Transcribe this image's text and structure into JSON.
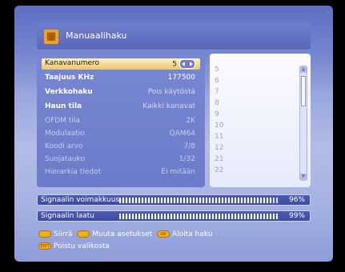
{
  "header": {
    "title": "Manuaalihaku",
    "icon": "menu-grid-icon"
  },
  "settings": [
    {
      "label": "Kanavanumero",
      "value": "5",
      "style": "highlight"
    },
    {
      "label": "Taajuus KHz",
      "value": "177500",
      "style": "bold"
    },
    {
      "label": "Verkkohaku",
      "value": "Pois käytöstä",
      "style": "bold-grey"
    },
    {
      "label": "Haun tila",
      "value": "Kaikki kanavat",
      "style": "bold-grey"
    },
    {
      "label": "OFDM tila",
      "value": "2K",
      "style": "dim"
    },
    {
      "label": "Modulaatio",
      "value": "QAM64",
      "style": "dim"
    },
    {
      "label": "Koodi arvo",
      "value": "7/8",
      "style": "dim"
    },
    {
      "label": "Suojatauko",
      "value": "1/32",
      "style": "dim"
    },
    {
      "label": "Hierarkia tiedot",
      "value": "Ei mitään",
      "style": "dim"
    }
  ],
  "channel_list": [
    "5",
    "6",
    "7",
    "8",
    "9",
    "10",
    "11",
    "12",
    "21",
    "22"
  ],
  "signal": {
    "strength": {
      "label": "Signaalin voimakkuus",
      "percent": 96,
      "percent_text": "96%"
    },
    "quality": {
      "label": "Signaalin laatu",
      "percent": 99,
      "percent_text": "99%"
    }
  },
  "help": {
    "move": "Siirrä",
    "change": "Muuta asetukset",
    "start": "Aloita haku",
    "exit": "Poistu valikosta",
    "ok_key": "OK",
    "exit_key": "EXIT"
  },
  "colors": {
    "highlight": "#ecc470",
    "accent_key": "#f2b018",
    "panel": "#7384cf"
  }
}
